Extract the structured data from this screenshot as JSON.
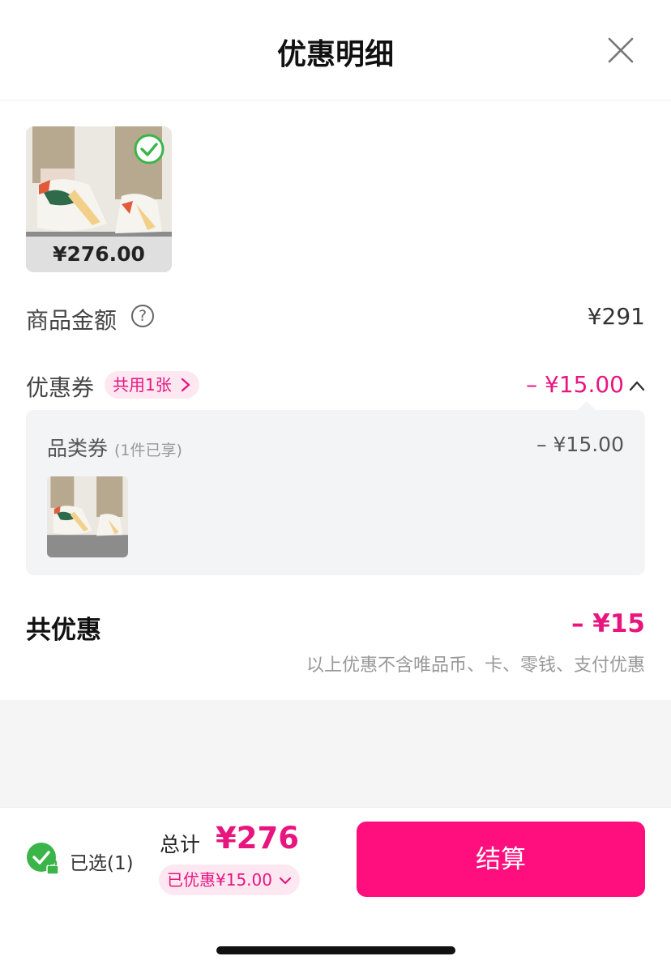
{
  "header": {
    "title": "优惠明细"
  },
  "product": {
    "price": "¥276.00"
  },
  "goods_amount": {
    "label": "商品金额",
    "help_icon": "?",
    "value": "¥291"
  },
  "coupon": {
    "label": "优惠券",
    "tag": "共用1张",
    "value": "– ¥15.00"
  },
  "coupon_detail": {
    "label": "品类券",
    "sub": "(1件已享)",
    "value": "– ¥15.00"
  },
  "total_discount": {
    "label": "共优惠",
    "value": "– ¥15",
    "note": "以上优惠不含唯品币、卡、零钱、支付优惠"
  },
  "footer": {
    "selected": "已选(1)",
    "total_label": "总计",
    "total_value": "¥276",
    "saved": "已优惠¥15.00",
    "checkout": "结算"
  },
  "colors": {
    "accent": "#ff0f7e",
    "accent_text": "#e8157f",
    "check_green": "#3bb54a"
  }
}
